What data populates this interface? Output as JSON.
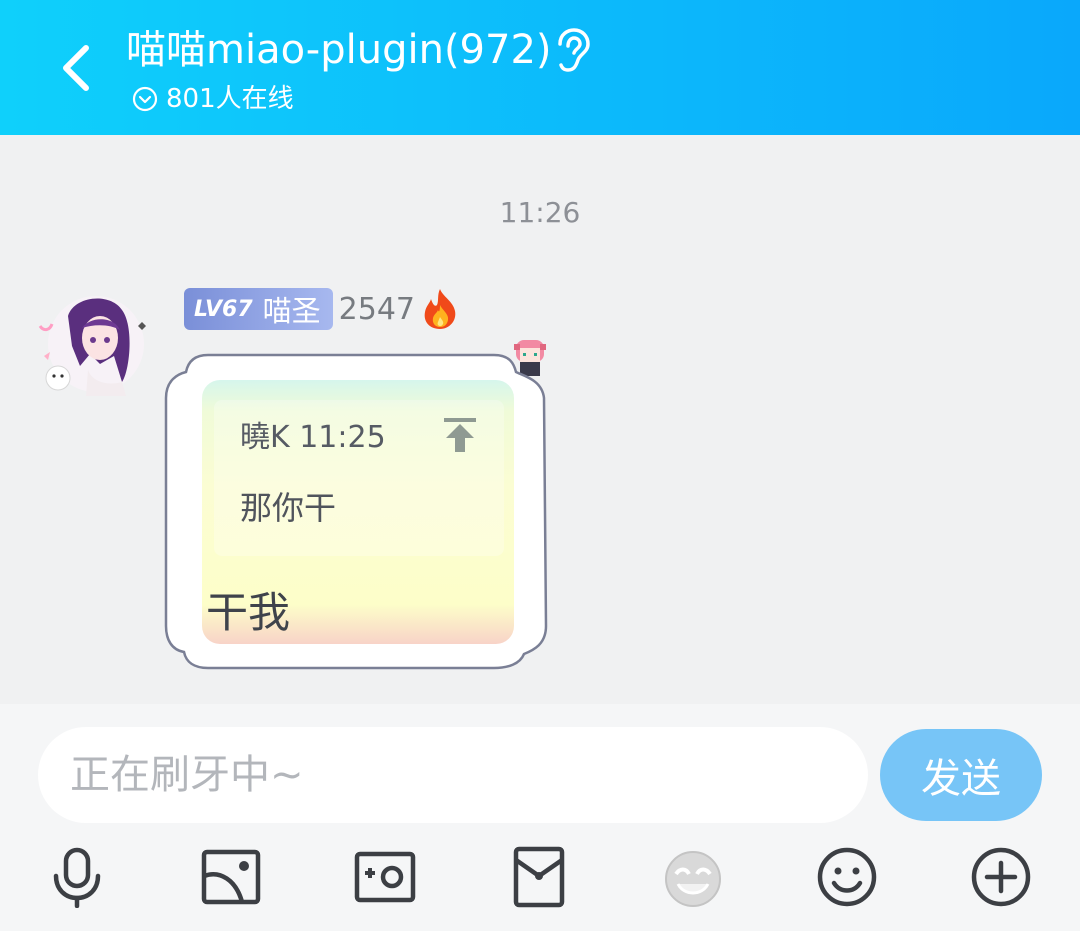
{
  "header": {
    "title": "喵喵miao-plugin(972)",
    "online_count": "801人在线",
    "icons": [
      "back-arrow-icon",
      "ear-icon",
      "chevron-circle-icon"
    ]
  },
  "chat": {
    "timestamp": "11:26",
    "message": {
      "level": "LV67",
      "nickname": "喵圣",
      "score": "2547",
      "quote_sender": "曉K 11:25",
      "quote_text": "那你干",
      "text": "干我"
    }
  },
  "input": {
    "placeholder": "正在刷牙中~",
    "send_label": "发送"
  },
  "toolbar": {
    "items": [
      "microphone-icon",
      "image-icon",
      "camera-icon",
      "red-envelope-icon",
      "sticker-icon",
      "emoji-icon",
      "plus-icon"
    ]
  },
  "colors": {
    "header_start": "#0fd0fb",
    "header_end": "#0aa8fb",
    "send_button": "#77c5f7",
    "background": "#f0f1f2"
  }
}
